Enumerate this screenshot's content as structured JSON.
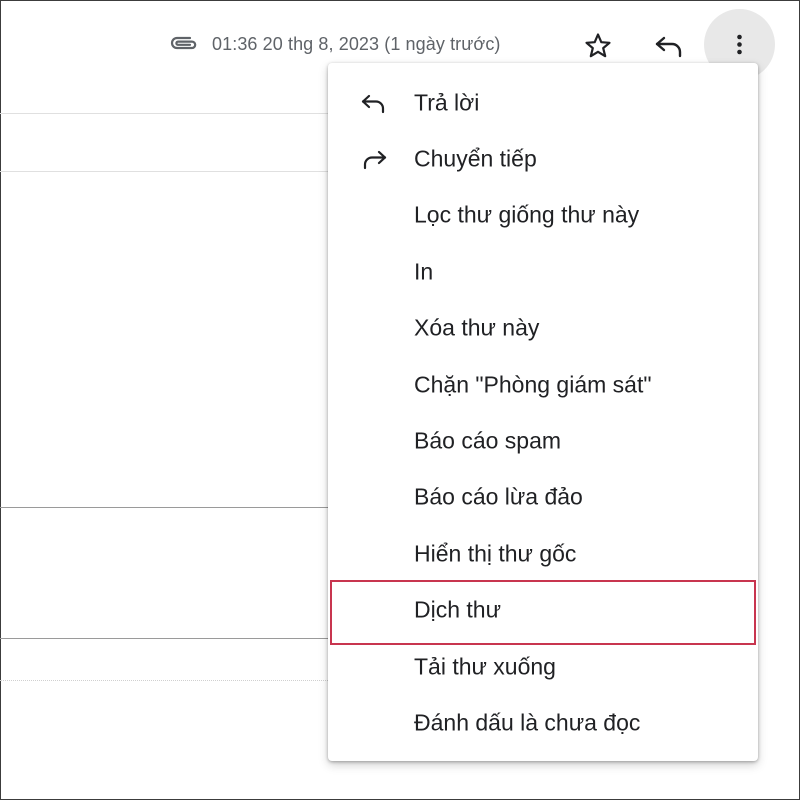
{
  "header": {
    "timestamp": "01:36 20 thg 8, 2023 (1 ngày trước)",
    "icons": {
      "attachment": "paperclip-icon",
      "star": "star-outline-icon",
      "reply": "reply-icon",
      "more": "more-vertical-icon"
    }
  },
  "menu": {
    "items": [
      {
        "label": "Trả lời",
        "icon": "reply-icon"
      },
      {
        "label": "Chuyển tiếp",
        "icon": "forward-icon"
      },
      {
        "label": "Lọc thư giống thư này"
      },
      {
        "label": "In"
      },
      {
        "label": "Xóa thư này"
      },
      {
        "label": "Chặn \"Phòng giám sát\""
      },
      {
        "label": "Báo cáo spam"
      },
      {
        "label": "Báo cáo lừa đảo"
      },
      {
        "label": "Hiển thị thư gốc"
      },
      {
        "label": "Dịch thư",
        "highlighted": true
      },
      {
        "label": "Tải thư xuống"
      },
      {
        "label": "Đánh dấu là chưa đọc"
      }
    ]
  },
  "colors": {
    "highlight_border": "#c8354f",
    "text": "#202124",
    "muted_text": "#5f6368",
    "more_button_bg": "#e8e8e8"
  }
}
